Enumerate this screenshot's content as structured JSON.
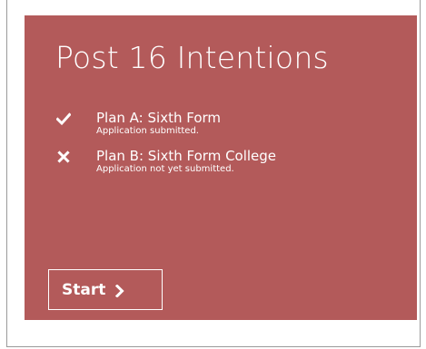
{
  "card": {
    "title": "Post 16 Intentions",
    "background_color": "#b35a5a",
    "plans": [
      {
        "name": "Plan A: Sixth Form",
        "status": "Application submitted.",
        "icon": "check-icon"
      },
      {
        "name": "Plan B: Sixth Form College",
        "status": "Application not yet submitted.",
        "icon": "cross-icon"
      }
    ],
    "start_label": "Start",
    "start_icon": "chevron-right-icon"
  }
}
